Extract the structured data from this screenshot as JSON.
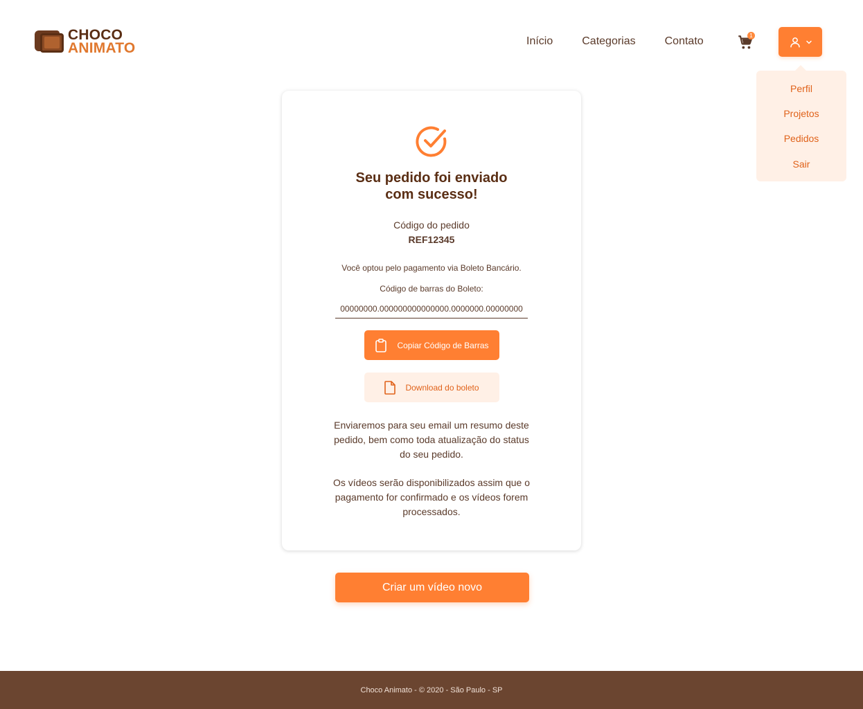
{
  "brand": {
    "line1": "CHOCO",
    "line2": "ANIMATO",
    "accent": "#ff7f32",
    "brown": "#5a2e14"
  },
  "nav": {
    "home": "Início",
    "categories": "Categorias",
    "contact": "Contato"
  },
  "cart": {
    "count": "1",
    "icon": "cart-icon"
  },
  "user_menu": {
    "icon": "user-icon",
    "items": [
      "Perfil",
      "Projetos",
      "Pedidos",
      "Sair"
    ]
  },
  "confirmation": {
    "title_line1": "Seu pedido foi enviado",
    "title_line2": "com sucesso!",
    "order_code_label": "Código do pedido",
    "order_code": "REF12345",
    "payment_text": "Você optou pelo pagamento via Boleto Bancário.",
    "barcode_label": "Código de barras do Boleto:",
    "barcode_value": "00000000.000000000000000.0000000.00000000",
    "copy_button": "Copiar Código de Barras",
    "download_button": "Download do boleto",
    "email_note": "Enviaremos para seu email um resumo deste pedido, bem como toda atualização do status do seu pedido.",
    "video_note": "Os vídeos serão disponibilizados assim que o pagamento for confirmado e os vídeos forem processados."
  },
  "new_video_button": "Criar um vídeo novo",
  "footer": {
    "text": "Choco Animato - © 2020 - São Paulo - SP"
  }
}
